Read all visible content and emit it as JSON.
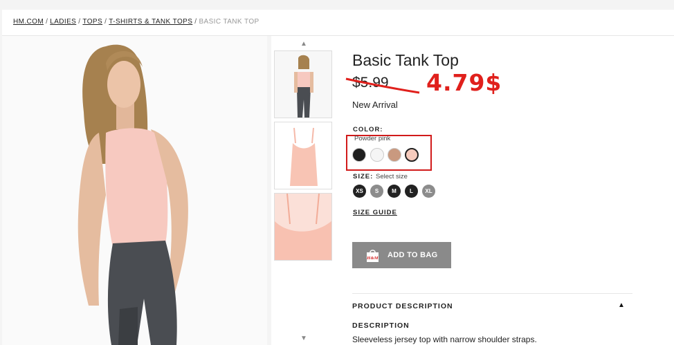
{
  "breadcrumb": {
    "items": [
      "HM.COM",
      "LADIES",
      "TOPS",
      "T-SHIRTS & TANK TOPS"
    ],
    "current": "BASIC TANK TOP",
    "separator": "/"
  },
  "product": {
    "title": "Basic Tank Top",
    "old_price": "$5.99",
    "sale_price": "4.79$",
    "badge": "New Arrival"
  },
  "color": {
    "label": "COLOR:",
    "selected_name": "Powder pink",
    "swatches": [
      {
        "name": "black",
        "hex": "#1f1f1f"
      },
      {
        "name": "white",
        "hex": "#f5f5f5"
      },
      {
        "name": "beige",
        "hex": "#c9997f"
      },
      {
        "name": "powder-pink",
        "hex": "#f6cbbd",
        "selected": true
      }
    ]
  },
  "size": {
    "label": "SIZE:",
    "placeholder": "Select size",
    "options": [
      {
        "label": "XS",
        "available": true
      },
      {
        "label": "S",
        "available": false
      },
      {
        "label": "M",
        "available": true
      },
      {
        "label": "L",
        "available": true
      },
      {
        "label": "XL",
        "available": false
      }
    ],
    "guide_label": "SIZE GUIDE"
  },
  "cart": {
    "button_label": "ADD TO BAG",
    "bag_logo": "H&M"
  },
  "description": {
    "section_title": "PRODUCT DESCRIPTION",
    "toggle_icon": "triangle-up-icon",
    "heading": "DESCRIPTION",
    "text": "Sleeveless jersey top with narrow shoulder straps."
  },
  "thumbnails": {
    "up_arrow": "▲",
    "down_arrow": "▼"
  },
  "colors": {
    "sale_red": "#e0201c",
    "highlight_box": "#d11a1a",
    "button_gray": "#8a8a8a"
  }
}
